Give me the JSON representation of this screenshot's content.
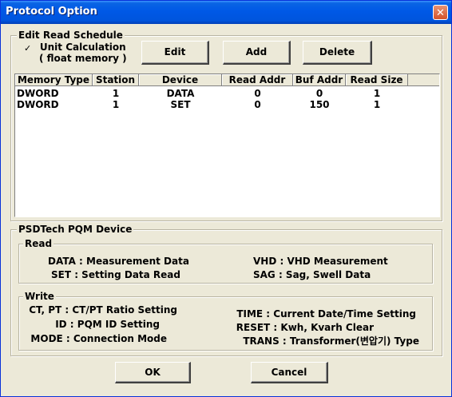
{
  "window": {
    "title": "Protocol Option",
    "close_glyph": "✕"
  },
  "schedule": {
    "group_label": "Edit Read Schedule",
    "unit_calc_label": "Unit Calculation",
    "unit_calc_sub": "( float memory )",
    "unit_calc_checked": true,
    "edit_label": "Edit",
    "add_label": "Add",
    "delete_label": "Delete"
  },
  "table": {
    "columns": [
      "Memory Type",
      "Station",
      "Device",
      "Read Addr",
      "Buf Addr",
      "Read Size"
    ],
    "rows": [
      [
        "DWORD",
        "1",
        "DATA",
        "0",
        "0",
        "1"
      ],
      [
        "DWORD",
        "1",
        "SET",
        "0",
        "150",
        "1"
      ]
    ]
  },
  "device": {
    "group_label": "PSDTech PQM Device",
    "read": {
      "label": "Read",
      "left": [
        "DATA : Measurement Data",
        "SET : Setting Data Read"
      ],
      "right": [
        "VHD : VHD Measurement",
        "SAG : Sag, Swell Data"
      ]
    },
    "write": {
      "label": "Write",
      "left": [
        "CT, PT : CT/PT Ratio Setting",
        "ID : PQM ID Setting",
        "MODE : Connection Mode"
      ],
      "right": [
        "TIME : Current Date/Time Setting",
        "RESET : Kwh, Kvarh Clear",
        "TRANS : Transformer(변압기) Type"
      ]
    }
  },
  "footer": {
    "ok_label": "OK",
    "cancel_label": "Cancel"
  },
  "colors": {
    "titlebar": "#0058e6",
    "face": "#ece9d8",
    "close": "#d5532a"
  }
}
